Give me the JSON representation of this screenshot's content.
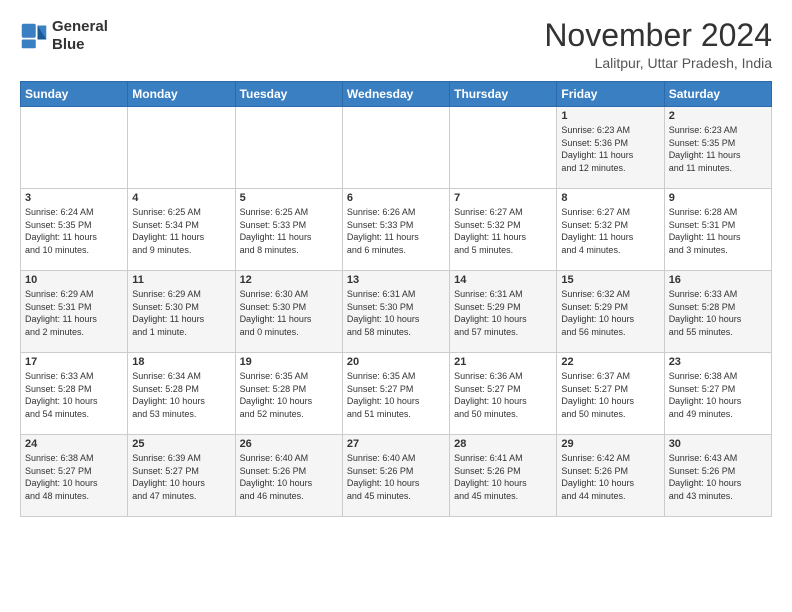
{
  "logo": {
    "line1": "General",
    "line2": "Blue"
  },
  "title": "November 2024",
  "location": "Lalitpur, Uttar Pradesh, India",
  "weekdays": [
    "Sunday",
    "Monday",
    "Tuesday",
    "Wednesday",
    "Thursday",
    "Friday",
    "Saturday"
  ],
  "weeks": [
    [
      {
        "day": "",
        "info": ""
      },
      {
        "day": "",
        "info": ""
      },
      {
        "day": "",
        "info": ""
      },
      {
        "day": "",
        "info": ""
      },
      {
        "day": "",
        "info": ""
      },
      {
        "day": "1",
        "info": "Sunrise: 6:23 AM\nSunset: 5:36 PM\nDaylight: 11 hours\nand 12 minutes."
      },
      {
        "day": "2",
        "info": "Sunrise: 6:23 AM\nSunset: 5:35 PM\nDaylight: 11 hours\nand 11 minutes."
      }
    ],
    [
      {
        "day": "3",
        "info": "Sunrise: 6:24 AM\nSunset: 5:35 PM\nDaylight: 11 hours\nand 10 minutes."
      },
      {
        "day": "4",
        "info": "Sunrise: 6:25 AM\nSunset: 5:34 PM\nDaylight: 11 hours\nand 9 minutes."
      },
      {
        "day": "5",
        "info": "Sunrise: 6:25 AM\nSunset: 5:33 PM\nDaylight: 11 hours\nand 8 minutes."
      },
      {
        "day": "6",
        "info": "Sunrise: 6:26 AM\nSunset: 5:33 PM\nDaylight: 11 hours\nand 6 minutes."
      },
      {
        "day": "7",
        "info": "Sunrise: 6:27 AM\nSunset: 5:32 PM\nDaylight: 11 hours\nand 5 minutes."
      },
      {
        "day": "8",
        "info": "Sunrise: 6:27 AM\nSunset: 5:32 PM\nDaylight: 11 hours\nand 4 minutes."
      },
      {
        "day": "9",
        "info": "Sunrise: 6:28 AM\nSunset: 5:31 PM\nDaylight: 11 hours\nand 3 minutes."
      }
    ],
    [
      {
        "day": "10",
        "info": "Sunrise: 6:29 AM\nSunset: 5:31 PM\nDaylight: 11 hours\nand 2 minutes."
      },
      {
        "day": "11",
        "info": "Sunrise: 6:29 AM\nSunset: 5:30 PM\nDaylight: 11 hours\nand 1 minute."
      },
      {
        "day": "12",
        "info": "Sunrise: 6:30 AM\nSunset: 5:30 PM\nDaylight: 11 hours\nand 0 minutes."
      },
      {
        "day": "13",
        "info": "Sunrise: 6:31 AM\nSunset: 5:30 PM\nDaylight: 10 hours\nand 58 minutes."
      },
      {
        "day": "14",
        "info": "Sunrise: 6:31 AM\nSunset: 5:29 PM\nDaylight: 10 hours\nand 57 minutes."
      },
      {
        "day": "15",
        "info": "Sunrise: 6:32 AM\nSunset: 5:29 PM\nDaylight: 10 hours\nand 56 minutes."
      },
      {
        "day": "16",
        "info": "Sunrise: 6:33 AM\nSunset: 5:28 PM\nDaylight: 10 hours\nand 55 minutes."
      }
    ],
    [
      {
        "day": "17",
        "info": "Sunrise: 6:33 AM\nSunset: 5:28 PM\nDaylight: 10 hours\nand 54 minutes."
      },
      {
        "day": "18",
        "info": "Sunrise: 6:34 AM\nSunset: 5:28 PM\nDaylight: 10 hours\nand 53 minutes."
      },
      {
        "day": "19",
        "info": "Sunrise: 6:35 AM\nSunset: 5:28 PM\nDaylight: 10 hours\nand 52 minutes."
      },
      {
        "day": "20",
        "info": "Sunrise: 6:35 AM\nSunset: 5:27 PM\nDaylight: 10 hours\nand 51 minutes."
      },
      {
        "day": "21",
        "info": "Sunrise: 6:36 AM\nSunset: 5:27 PM\nDaylight: 10 hours\nand 50 minutes."
      },
      {
        "day": "22",
        "info": "Sunrise: 6:37 AM\nSunset: 5:27 PM\nDaylight: 10 hours\nand 50 minutes."
      },
      {
        "day": "23",
        "info": "Sunrise: 6:38 AM\nSunset: 5:27 PM\nDaylight: 10 hours\nand 49 minutes."
      }
    ],
    [
      {
        "day": "24",
        "info": "Sunrise: 6:38 AM\nSunset: 5:27 PM\nDaylight: 10 hours\nand 48 minutes."
      },
      {
        "day": "25",
        "info": "Sunrise: 6:39 AM\nSunset: 5:27 PM\nDaylight: 10 hours\nand 47 minutes."
      },
      {
        "day": "26",
        "info": "Sunrise: 6:40 AM\nSunset: 5:26 PM\nDaylight: 10 hours\nand 46 minutes."
      },
      {
        "day": "27",
        "info": "Sunrise: 6:40 AM\nSunset: 5:26 PM\nDaylight: 10 hours\nand 45 minutes."
      },
      {
        "day": "28",
        "info": "Sunrise: 6:41 AM\nSunset: 5:26 PM\nDaylight: 10 hours\nand 45 minutes."
      },
      {
        "day": "29",
        "info": "Sunrise: 6:42 AM\nSunset: 5:26 PM\nDaylight: 10 hours\nand 44 minutes."
      },
      {
        "day": "30",
        "info": "Sunrise: 6:43 AM\nSunset: 5:26 PM\nDaylight: 10 hours\nand 43 minutes."
      }
    ]
  ]
}
